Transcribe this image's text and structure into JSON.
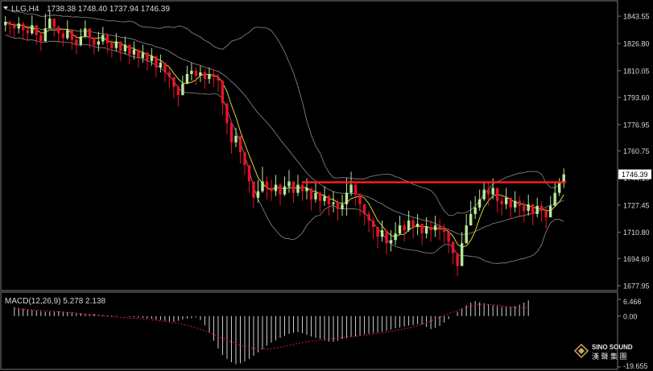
{
  "header": {
    "symbol_timeframe": "LLG,H4",
    "ohlc": "1738.38 1748.40 1737.94 1746.39"
  },
  "macd_header": "MACD(12,26,9) 5.278 2.138",
  "logo": {
    "line1": "SINO SOUND",
    "line2": "漢 聲 集 團"
  },
  "colors": {
    "background": "#000000",
    "grid_border": "#7a7a7a",
    "up_candle": "#b8e89a",
    "down_candle": "#e8122a",
    "bollinger": "#8c8c8c",
    "moving_average": "#d8d23a",
    "resistance_line": "#ff1a1a",
    "macd_hist": "#cfcfcf",
    "macd_signal": "#e8122a",
    "price_tag_bg": "#ffffff",
    "text": "#d8d8d8"
  },
  "chart_data": [
    {
      "type": "candlestick",
      "title": "LLG,H4",
      "yaxis_ticks": [
        "1843.55",
        "1826.80",
        "1810.05",
        "1793.60",
        "1776.95",
        "1760.75",
        "1744.10",
        "1727.45",
        "1710.80",
        "1694.60",
        "1677.95"
      ],
      "ylim": [
        1677.95,
        1851
      ],
      "current_price": "1746.39",
      "resistance_level": 1741.5,
      "grid": false,
      "overlays": [
        "Bollinger Bands",
        "Moving Average"
      ],
      "close": [
        1840,
        1838,
        1836,
        1839,
        1835,
        1833,
        1838,
        1832,
        1828,
        1836,
        1842,
        1837,
        1833,
        1830,
        1835,
        1829,
        1826,
        1831,
        1836,
        1830,
        1826,
        1828,
        1832,
        1827,
        1824,
        1828,
        1822,
        1826,
        1820,
        1823,
        1818,
        1821,
        1816,
        1819,
        1812,
        1815,
        1809,
        1806,
        1800,
        1795,
        1802,
        1808,
        1810,
        1807,
        1809,
        1805,
        1808,
        1806,
        1804,
        1790,
        1778,
        1766,
        1770,
        1760,
        1752,
        1742,
        1732,
        1736,
        1742,
        1738,
        1736,
        1740,
        1734,
        1739,
        1742,
        1735,
        1740,
        1736,
        1738,
        1731,
        1735,
        1730,
        1733,
        1728,
        1729,
        1725,
        1728,
        1735,
        1740,
        1734,
        1728,
        1722,
        1718,
        1714,
        1708,
        1712,
        1704,
        1706,
        1710,
        1715,
        1712,
        1718,
        1714,
        1716,
        1710,
        1714,
        1712,
        1715,
        1713,
        1711,
        1705,
        1698,
        1690,
        1704,
        1715,
        1722,
        1726,
        1731,
        1737,
        1734,
        1738,
        1730,
        1728,
        1732,
        1726,
        1730,
        1727,
        1724,
        1728,
        1722,
        1727,
        1724,
        1720,
        1727,
        1735,
        1741,
        1746.39
      ],
      "high": [
        1843.5,
        1841,
        1840,
        1843,
        1840,
        1838,
        1844,
        1838,
        1834,
        1845,
        1847,
        1842,
        1838,
        1836,
        1841,
        1834,
        1832,
        1836,
        1841,
        1836,
        1831,
        1834,
        1837,
        1833,
        1829,
        1833,
        1827,
        1831,
        1826,
        1828,
        1823,
        1826,
        1822,
        1824,
        1817,
        1820,
        1814,
        1812,
        1805,
        1801,
        1807,
        1813,
        1815,
        1812,
        1813,
        1811,
        1812,
        1811,
        1808,
        1798,
        1785,
        1774,
        1775,
        1766,
        1760,
        1750,
        1742,
        1743,
        1751,
        1745,
        1743,
        1746,
        1741,
        1745,
        1749,
        1742,
        1746,
        1742,
        1744,
        1738,
        1741,
        1736,
        1739,
        1734,
        1736,
        1731,
        1734,
        1744,
        1748,
        1741,
        1735,
        1728,
        1724,
        1720,
        1714,
        1718,
        1710,
        1712,
        1717,
        1721,
        1718,
        1724,
        1720,
        1722,
        1716,
        1720,
        1718,
        1721,
        1719,
        1716,
        1711,
        1704,
        1697,
        1711,
        1722,
        1730,
        1733,
        1737,
        1742,
        1741,
        1744,
        1737,
        1734,
        1738,
        1732,
        1736,
        1733,
        1730,
        1734,
        1728,
        1732,
        1730,
        1726,
        1733,
        1741,
        1744,
        1750
      ],
      "low": [
        1834,
        1832,
        1830,
        1833,
        1829,
        1828,
        1832,
        1826,
        1822,
        1830,
        1836,
        1831,
        1827,
        1825,
        1829,
        1823,
        1820,
        1825,
        1830,
        1824,
        1820,
        1822,
        1826,
        1821,
        1818,
        1822,
        1816,
        1820,
        1814,
        1817,
        1812,
        1815,
        1810,
        1813,
        1806,
        1809,
        1803,
        1799,
        1793,
        1788,
        1796,
        1802,
        1804,
        1801,
        1803,
        1799,
        1802,
        1800,
        1797,
        1783,
        1771,
        1759,
        1763,
        1753,
        1746,
        1735,
        1726,
        1729,
        1735,
        1731,
        1730,
        1733,
        1727,
        1733,
        1735,
        1729,
        1733,
        1730,
        1731,
        1724,
        1729,
        1723,
        1727,
        1721,
        1723,
        1718,
        1721,
        1721,
        1733,
        1727,
        1721,
        1715,
        1711,
        1707,
        1701,
        1705,
        1697,
        1699,
        1703,
        1709,
        1705,
        1711,
        1707,
        1709,
        1703,
        1707,
        1705,
        1708,
        1706,
        1704,
        1698,
        1691,
        1684,
        1697,
        1708,
        1715,
        1719,
        1724,
        1730,
        1727,
        1731,
        1723,
        1721,
        1725,
        1719,
        1723,
        1720,
        1717,
        1721,
        1715,
        1720,
        1717,
        1713,
        1720,
        1727,
        1733,
        1738
      ]
    },
    {
      "type": "bar",
      "title": "MACD(12,26,9)",
      "macd_value": 5.278,
      "signal_value": 2.138,
      "yaxis_ticks": [
        "6.466",
        "0.00",
        "-19.655"
      ],
      "ylim": [
        -19.655,
        6.466
      ],
      "hist_from": 2,
      "values": [
        3.5,
        3.2,
        2.9,
        2.6,
        2.4,
        2.1,
        1.9,
        1.7,
        1.6,
        1.7,
        1.9,
        1.8,
        1.6,
        1.4,
        1.3,
        1.1,
        0.9,
        0.8,
        0.8,
        0.6,
        0.4,
        0.3,
        0.3,
        0.2,
        0.0,
        -0.1,
        -0.3,
        -0.4,
        -0.6,
        -0.7,
        -0.9,
        -1.0,
        -1.3,
        -1.5,
        -1.8,
        -2.0,
        -2.2,
        -1.8,
        -1.3,
        -1.0,
        -0.8,
        -0.5,
        -1.5,
        -3.5,
        -6.5,
        -9.5,
        -12.5,
        -15.0,
        -16.5,
        -17.8,
        -18.6,
        -18.2,
        -17.5,
        -16.5,
        -15.3,
        -14.0,
        -12.8,
        -11.4,
        -10.2,
        -9.4,
        -8.4,
        -7.6,
        -6.9,
        -6.4,
        -6.2,
        -6.6,
        -7.2,
        -7.9,
        -8.4,
        -8.8,
        -9.4,
        -9.8,
        -9.9,
        -9.5,
        -8.9,
        -8.5,
        -8.1,
        -7.8,
        -7.5,
        -7.0,
        -6.8,
        -6.5,
        -6.3,
        -6.0,
        -5.6,
        -5.2,
        -4.7,
        -4.4,
        -4.0,
        -3.7,
        -3.5,
        -3.1,
        -3.2,
        -4.2,
        -5.0,
        -4.6,
        -3.8,
        -2.5,
        -1.2,
        0.0,
        1.6,
        3.0,
        4.2,
        5.2,
        5.8,
        5.4,
        5.0,
        4.6,
        4.2,
        3.9,
        3.6,
        3.6,
        3.7,
        3.9,
        4.4,
        5.2,
        6.1
      ],
      "signal": [
        2.6,
        2.6,
        2.5,
        2.3,
        2.1,
        1.9,
        1.6,
        1.4,
        1.2,
        0.9,
        0.6,
        0.3,
        0.0,
        -0.3,
        -0.5,
        -0.7,
        -0.9,
        -1.1,
        -1.4,
        -1.7,
        -2.1,
        -2.5,
        -3.0,
        -3.7,
        -4.5,
        -5.5,
        -6.6,
        -7.8,
        -9.1,
        -10.3,
        -11.3,
        -12.1,
        -12.6,
        -12.8,
        -12.6,
        -12.1,
        -11.5,
        -10.9,
        -10.3,
        -9.8,
        -9.4,
        -9.0,
        -8.7,
        -8.4,
        -8.1,
        -7.8,
        -7.5,
        -7.1,
        -6.7,
        -6.3,
        -5.8,
        -5.3,
        -4.7,
        -4.0,
        -3.1,
        -2.0,
        -0.8,
        0.4,
        1.5,
        2.6,
        3.6,
        4.3,
        4.6,
        4.5,
        4.2,
        3.8,
        3.4,
        2.9,
        3.5
      ]
    }
  ]
}
